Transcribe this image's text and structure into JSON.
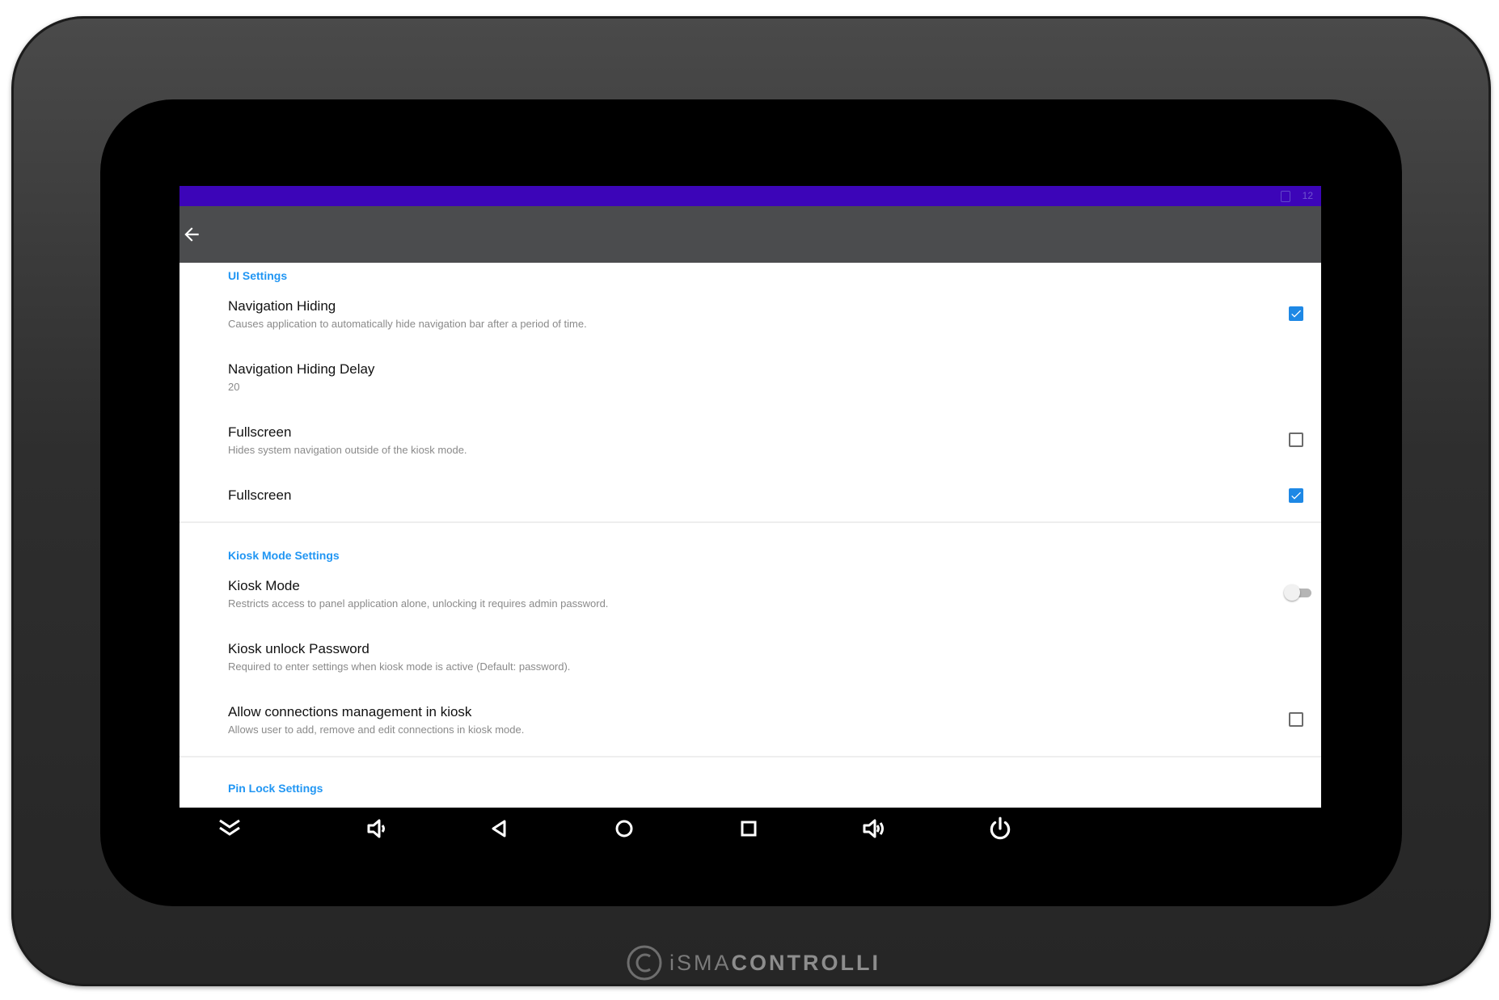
{
  "status_bar": {
    "time": "12",
    "color": "#3c05b8"
  },
  "app_bar": {
    "back_icon": "arrow-left-icon"
  },
  "sections": {
    "ui": {
      "header": "UI Settings",
      "navigation_hiding": {
        "title": "Navigation Hiding",
        "summary": "Causes application to automatically hide navigation bar after a period of time.",
        "checked": true
      },
      "navigation_hiding_delay": {
        "title": "Navigation Hiding Delay",
        "summary": "20"
      },
      "fullscreen": {
        "title": "Fullscreen",
        "summary": "Hides system navigation outside of the kiosk mode.",
        "checked": false
      },
      "fullscreen_2": {
        "title": "Fullscreen",
        "checked": true
      }
    },
    "kiosk": {
      "header": "Kiosk Mode Settings",
      "kiosk_mode": {
        "title": "Kiosk Mode",
        "summary": "Restricts access to panel application alone, unlocking it requires admin password.",
        "enabled": false
      },
      "kiosk_password": {
        "title": "Kiosk unlock Password",
        "summary": "Required to enter settings when kiosk mode is active (Default: password)."
      },
      "allow_connections": {
        "title": "Allow connections management in kiosk",
        "summary": "Allows user to add, remove and edit connections in kiosk mode.",
        "checked": false
      }
    },
    "pin": {
      "header": "Pin Lock Settings"
    }
  },
  "nav_bar": {
    "buttons": [
      "collapse-icon",
      "volume-down-icon",
      "back-icon",
      "home-icon",
      "recents-icon",
      "volume-up-icon",
      "power-icon"
    ]
  },
  "brand": {
    "light": "iSMA",
    "bold": "CONTROLLI"
  },
  "colors": {
    "accent": "#2196f3",
    "checkbox": "#1e88e5",
    "app_bar": "#4b4c4e"
  }
}
